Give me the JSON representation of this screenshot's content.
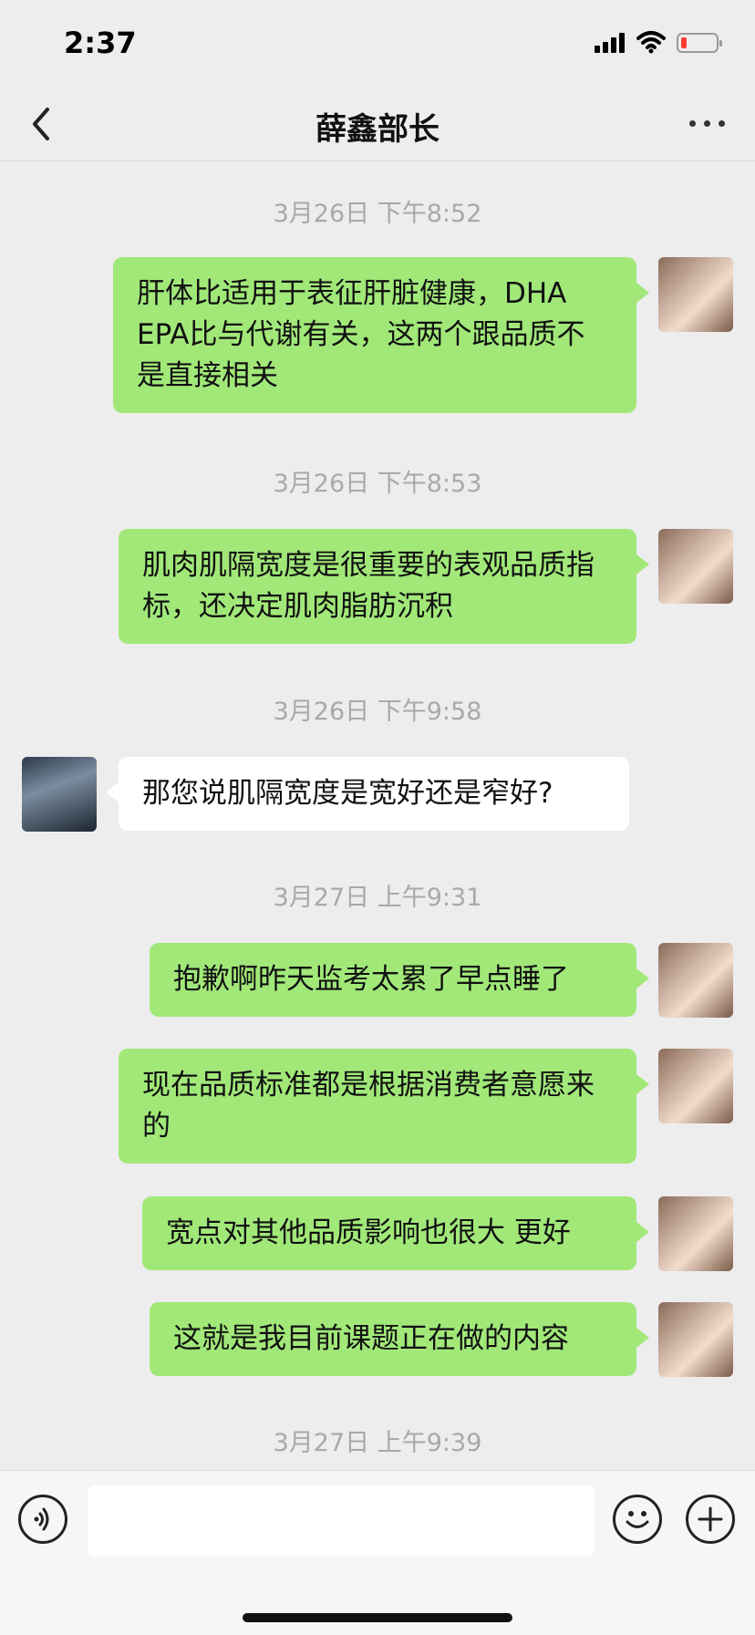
{
  "status": {
    "time": "2:37"
  },
  "nav": {
    "title": "薛鑫部长"
  },
  "messages": [
    {
      "time": "3月26日 下午8:52"
    },
    {
      "text": "肝体比适用于表征肝脏健康，DHA EPA比与代谢有关，这两个跟品质不是直接相关"
    },
    {
      "time": "3月26日 下午8:53"
    },
    {
      "text": "肌肉肌隔宽度是很重要的表观品质指标，还决定肌肉脂肪沉积"
    },
    {
      "time": "3月26日 下午9:58"
    },
    {
      "text": "那您说肌隔宽度是宽好还是窄好?"
    },
    {
      "time": "3月27日 上午9:31"
    },
    {
      "text": "抱歉啊昨天监考太累了早点睡了"
    },
    {
      "text": "现在品质标准都是根据消费者意愿来的"
    },
    {
      "text": "宽点对其他品质影响也很大 更好"
    },
    {
      "text": "这就是我目前课题正在做的内容"
    },
    {
      "time": "3月27日 上午9:39"
    }
  ],
  "input": {
    "placeholder": ""
  },
  "colors": {
    "sent_bubble": "#a1e879",
    "received_bubble": "#ffffff",
    "background": "#ededed"
  }
}
